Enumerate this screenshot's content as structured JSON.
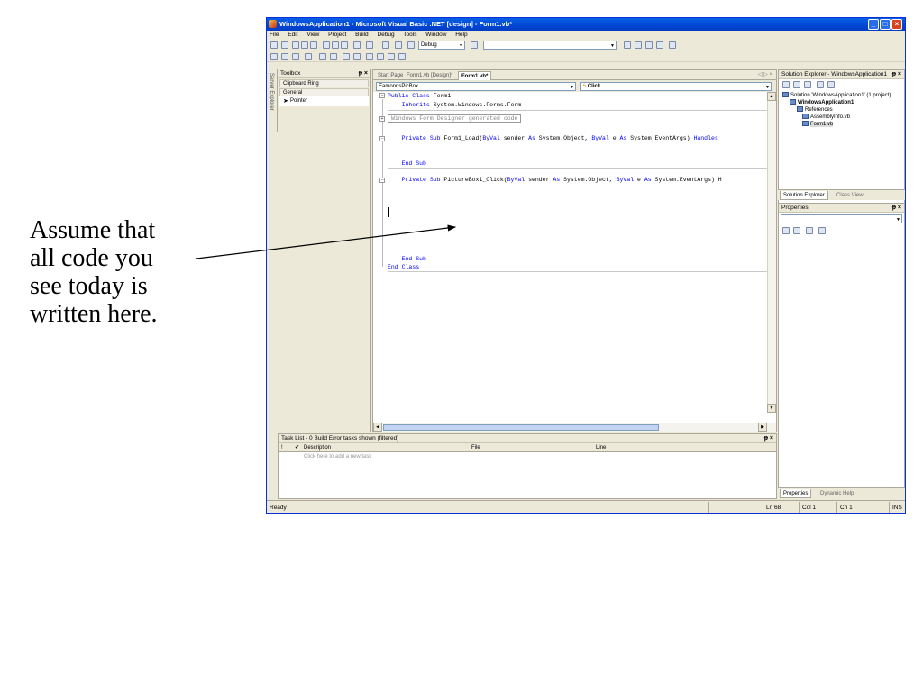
{
  "caption": {
    "lines": [
      "Assume that",
      "all code you",
      "see today is",
      "written here."
    ]
  },
  "window": {
    "title": "WindowsApplication1 - Microsoft Visual Basic .NET [design] - Form1.vb*"
  },
  "menu": [
    "File",
    "Edit",
    "View",
    "Project",
    "Build",
    "Debug",
    "Tools",
    "Window",
    "Help"
  ],
  "toolbar": {
    "config": "Debug"
  },
  "toolbox": {
    "title": "Toolbox",
    "sections": [
      "Clipboard Ring",
      "General"
    ],
    "items": [
      "Pointer"
    ],
    "server_explorer": "Server Explorer"
  },
  "editor": {
    "tabs": [
      "Start Page",
      "Form1.vb [Design]*",
      "Form1.vb*"
    ],
    "class_combo": "EamonnsPicBox",
    "method_combo": "Click",
    "code": [
      {
        "pre": "",
        "kw": "Public Class",
        "post": " Form1"
      },
      {
        "pre": "    ",
        "kw": "Inherits",
        "post": " System.Windows.Forms.Form"
      },
      {
        "region": "Windows Form Designer generated code"
      },
      {
        "pre": "    ",
        "kw": "Private Sub",
        "post": " Form1_Load(",
        "kw2": "ByVal",
        "post2": " sender ",
        "kw3": "As",
        "post3": " System.Object, ",
        "kw4": "ByVal",
        "post4": " e ",
        "kw5": "As",
        "post5": " System.EventArgs) ",
        "kw6": "Handles",
        "post6": ""
      },
      {
        "pre": "    ",
        "kw": "End Sub",
        "post": ""
      },
      {
        "pre": "    ",
        "kw": "Private Sub",
        "post": " PictureBox1_Click(",
        "kw2": "ByVal",
        "post2": " sender ",
        "kw3": "As",
        "post3": " System.Object, ",
        "kw4": "ByVal",
        "post4": " e ",
        "kw5": "As",
        "post5": " System.EventArgs) H",
        "kw6": "",
        "post6": ""
      },
      {
        "pre": "    ",
        "kw": "End Sub",
        "post": ""
      },
      {
        "pre": "",
        "kw": "End Class",
        "post": ""
      }
    ]
  },
  "solution_explorer": {
    "title": "Solution Explorer - WindowsApplication1",
    "tree": [
      "Solution 'WindowsApplication1' (1 project)",
      "WindowsApplication1",
      "References",
      "AssemblyInfo.vb",
      "Form1.vb"
    ],
    "tabs": [
      "Solution Explorer",
      "Class View"
    ]
  },
  "properties": {
    "title": "Properties",
    "tabs": [
      "Properties",
      "Dynamic Help"
    ]
  },
  "tasklist": {
    "title": "Task List - 0 Build Error tasks shown (filtered)",
    "columns": [
      "!",
      "✔",
      "Description",
      "File",
      "Line"
    ],
    "placeholder": "Click here to add a new task"
  },
  "status": {
    "text": "Ready",
    "ln": "Ln 68",
    "col": "Col 1",
    "ch": "Ch 1",
    "mode": "INS"
  }
}
